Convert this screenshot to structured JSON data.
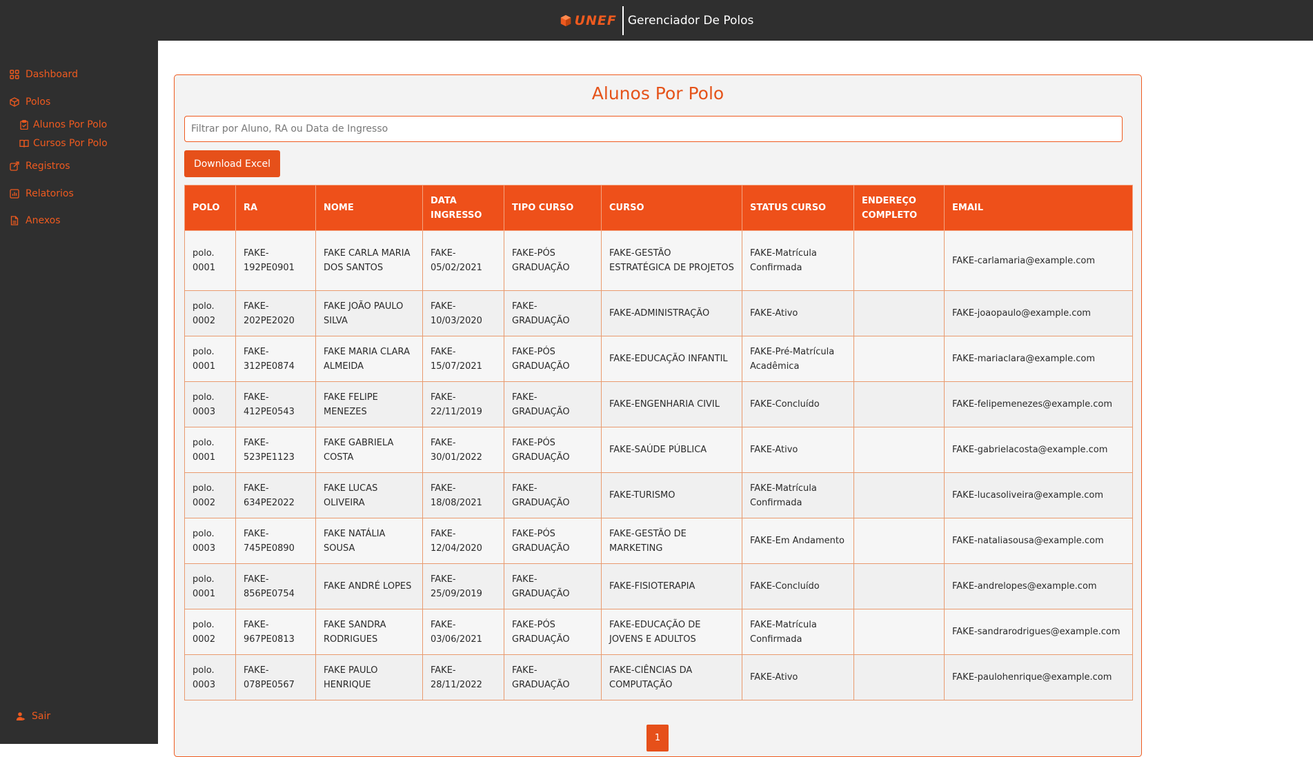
{
  "header": {
    "logo_text": "UNEF",
    "app_title": "Gerenciador De Polos"
  },
  "sidebar": {
    "items": [
      {
        "label": "Dashboard",
        "icon": "dashboard-icon"
      },
      {
        "label": "Polos",
        "icon": "box-icon"
      },
      {
        "label": "Alunos Por Polo",
        "icon": "clipboard-icon"
      },
      {
        "label": "Cursos Por Polo",
        "icon": "book-icon"
      },
      {
        "label": "Registros",
        "icon": "registry-icon"
      },
      {
        "label": "Relatorios",
        "icon": "chart-icon"
      },
      {
        "label": "Anexos",
        "icon": "file-icon"
      }
    ],
    "logout_label": "Sair"
  },
  "main": {
    "title": "Alunos Por Polo",
    "filter_placeholder": "Filtrar por Aluno, RA ou Data de Ingresso",
    "download_label": "Download Excel",
    "columns": [
      "POLO",
      "RA",
      "NOME",
      "DATA INGRESSO",
      "TIPO CURSO",
      "CURSO",
      "STATUS CURSO",
      "ENDEREÇO COMPLETO",
      "EMAIL"
    ],
    "rows": [
      [
        "polo. 0001",
        "FAKE-192PE0901",
        "FAKE CARLA MARIA DOS SANTOS",
        "FAKE-05/02/2021",
        "FAKE-PÓS GRADUAÇÃO",
        "FAKE-GESTÃO ESTRATÉGICA DE PROJETOS",
        "FAKE-Matrícula Confirmada",
        "",
        "FAKE-carlamaria@example.com"
      ],
      [
        "polo. 0002",
        "FAKE-202PE2020",
        "FAKE JOÃO PAULO SILVA",
        "FAKE-10/03/2020",
        "FAKE-GRADUAÇÃO",
        "FAKE-ADMINISTRAÇÃO",
        "FAKE-Ativo",
        "",
        "FAKE-joaopaulo@example.com"
      ],
      [
        "polo. 0001",
        "FAKE-312PE0874",
        "FAKE MARIA CLARA ALMEIDA",
        "FAKE-15/07/2021",
        "FAKE-PÓS GRADUAÇÃO",
        "FAKE-EDUCAÇÃO INFANTIL",
        "FAKE-Pré-Matrícula Acadêmica",
        "",
        "FAKE-mariaclara@example.com"
      ],
      [
        "polo. 0003",
        "FAKE-412PE0543",
        "FAKE FELIPE MENEZES",
        "FAKE-22/11/2019",
        "FAKE-GRADUAÇÃO",
        "FAKE-ENGENHARIA CIVIL",
        "FAKE-Concluído",
        "",
        "FAKE-felipemenezes@example.com"
      ],
      [
        "polo. 0001",
        "FAKE-523PE1123",
        "FAKE GABRIELA COSTA",
        "FAKE-30/01/2022",
        "FAKE-PÓS GRADUAÇÃO",
        "FAKE-SAÚDE PÚBLICA",
        "FAKE-Ativo",
        "",
        "FAKE-gabrielacosta@example.com"
      ],
      [
        "polo. 0002",
        "FAKE-634PE2022",
        "FAKE LUCAS OLIVEIRA",
        "FAKE-18/08/2021",
        "FAKE-GRADUAÇÃO",
        "FAKE-TURISMO",
        "FAKE-Matrícula Confirmada",
        "",
        "FAKE-lucasoliveira@example.com"
      ],
      [
        "polo. 0003",
        "FAKE-745PE0890",
        "FAKE NATÁLIA SOUSA",
        "FAKE-12/04/2020",
        "FAKE-PÓS GRADUAÇÃO",
        "FAKE-GESTÃO DE MARKETING",
        "FAKE-Em Andamento",
        "",
        "FAKE-nataliasousa@example.com"
      ],
      [
        "polo. 0001",
        "FAKE-856PE0754",
        "FAKE ANDRÉ LOPES",
        "FAKE-25/09/2019",
        "FAKE-GRADUAÇÃO",
        "FAKE-FISIOTERAPIA",
        "FAKE-Concluído",
        "",
        "FAKE-andrelopes@example.com"
      ],
      [
        "polo. 0002",
        "FAKE-967PE0813",
        "FAKE SANDRA RODRIGUES",
        "FAKE-03/06/2021",
        "FAKE-PÓS GRADUAÇÃO",
        "FAKE-EDUCAÇÃO DE JOVENS E ADULTOS",
        "FAKE-Matrícula Confirmada",
        "",
        "FAKE-sandrarodrigues@example.com"
      ],
      [
        "polo. 0003",
        "FAKE-078PE0567",
        "FAKE PAULO HENRIQUE",
        "FAKE-28/11/2022",
        "FAKE-GRADUAÇÃO",
        "FAKE-CIÊNCIAS DA COMPUTAÇÃO",
        "FAKE-Ativo",
        "",
        "FAKE-paulohenrique@example.com"
      ]
    ],
    "pagination": {
      "current": "1"
    }
  },
  "colors": {
    "accent": "#ee5a1f",
    "sidebar_bg": "#2f2f2f",
    "card_bg": "#f3f3f3"
  }
}
